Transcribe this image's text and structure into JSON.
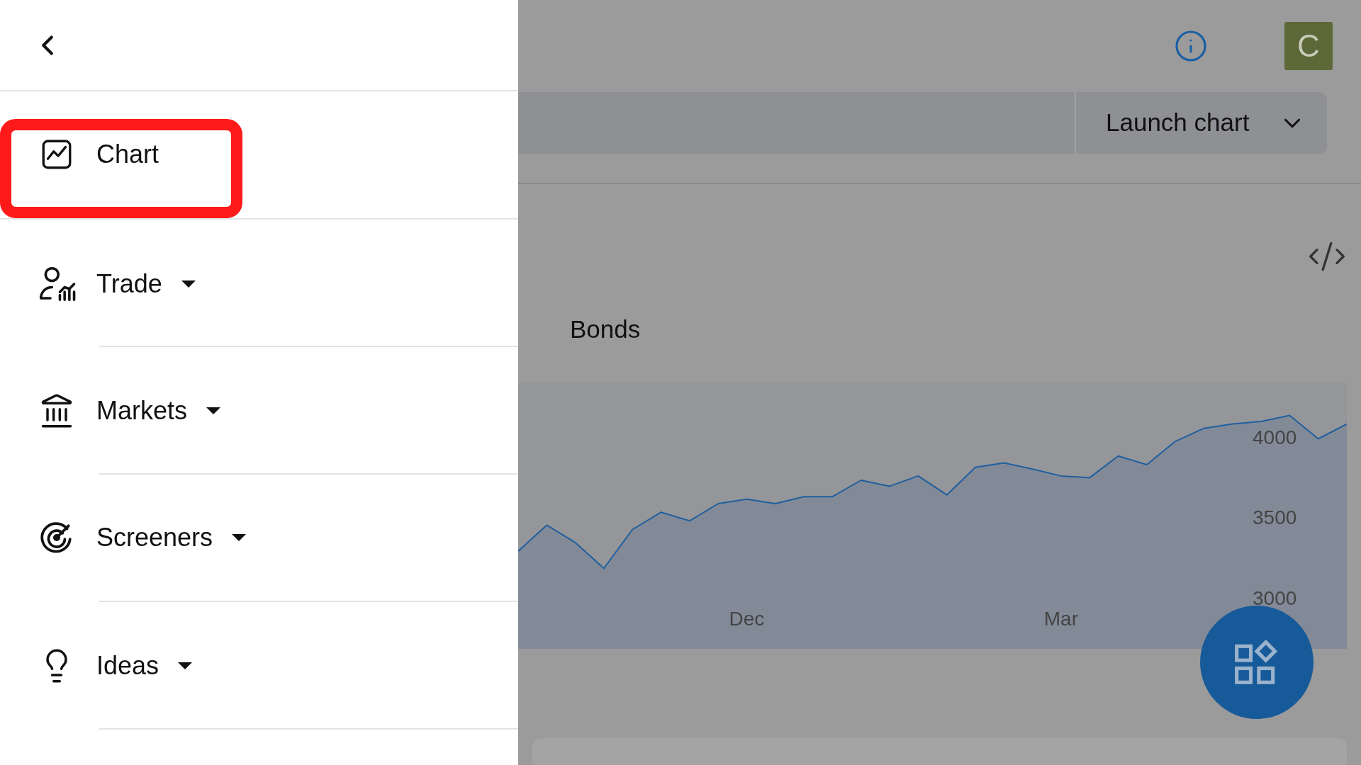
{
  "menu": {
    "items": [
      {
        "label": "Chart",
        "kind": "link",
        "highlighted": true
      },
      {
        "label": "Trade",
        "kind": "dropdown",
        "highlighted": false
      },
      {
        "label": "Markets",
        "kind": "dropdown",
        "highlighted": false
      },
      {
        "label": "Screeners",
        "kind": "dropdown",
        "highlighted": false
      },
      {
        "label": "Ideas",
        "kind": "dropdown",
        "highlighted": false
      }
    ]
  },
  "header": {
    "avatar": "C"
  },
  "toolbar": {
    "launch_button": "Launch chart"
  },
  "tabs": [
    {
      "label": "Bonds"
    }
  ],
  "chart": {
    "chart_data": {
      "type": "area",
      "categories": [
        null,
        null,
        null,
        null,
        null,
        null,
        null,
        null,
        "Dec",
        null,
        null,
        null,
        null,
        null,
        null,
        null,
        null,
        null,
        null,
        "Mar",
        null,
        null,
        null,
        null,
        null,
        null,
        null,
        null,
        null,
        null
      ],
      "series": [
        {
          "color": "#1f5f9e",
          "values": [
            3290,
            3452,
            3344,
            3183,
            3425,
            3532,
            3479,
            3586,
            3613,
            3586,
            3629,
            3629,
            3731,
            3694,
            3758,
            3640,
            3812,
            3839,
            3801,
            3758,
            3747,
            3882,
            3828,
            3973,
            4054,
            4081,
            4097,
            4134,
            3989,
            4081
          ]
        }
      ],
      "ylim": [
        2683,
        4339
      ],
      "yticks": [
        4000,
        3500,
        3000
      ]
    }
  }
}
